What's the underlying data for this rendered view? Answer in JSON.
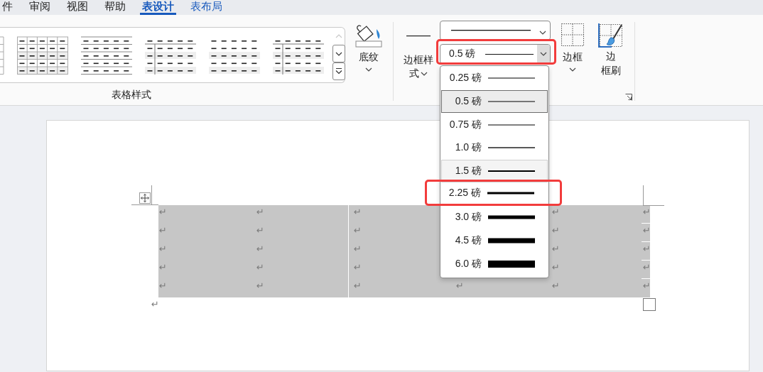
{
  "tabs": [
    {
      "label": "件",
      "selected": false,
      "kind": "normal"
    },
    {
      "label": "审阅",
      "selected": false,
      "kind": "normal"
    },
    {
      "label": "视图",
      "selected": false,
      "kind": "normal"
    },
    {
      "label": "帮助",
      "selected": false,
      "kind": "normal"
    },
    {
      "label": "表设计",
      "selected": true,
      "kind": "contextual"
    },
    {
      "label": "表布局",
      "selected": false,
      "kind": "contextual"
    }
  ],
  "table_styles": {
    "label": "表格样式",
    "scroll_up_disabled": true,
    "thumbnails": [
      {
        "kind": "partial"
      },
      {
        "kind": "grid"
      },
      {
        "kind": "lines"
      },
      {
        "kind": "header-column"
      },
      {
        "kind": "banded"
      },
      {
        "kind": "header-column"
      }
    ]
  },
  "shading": {
    "label": "底纹"
  },
  "border_styles": {
    "label_lines": [
      "边框样",
      "式"
    ]
  },
  "pen_weight": {
    "value": "0.5 磅",
    "expanded": true,
    "marked": true
  },
  "borders": {
    "label_lines": [
      "边框"
    ]
  },
  "border_painter": {
    "label_lines": [
      "边",
      "框刷"
    ]
  },
  "weight_options": [
    {
      "label": "0.25 磅",
      "selected": false,
      "hovered": false,
      "marked": false
    },
    {
      "label": "0.5 磅",
      "selected": true,
      "hovered": false,
      "marked": false
    },
    {
      "label": "0.75 磅",
      "selected": false,
      "hovered": false,
      "marked": false
    },
    {
      "label": "1.0 磅",
      "selected": false,
      "hovered": false,
      "marked": false
    },
    {
      "label": "1.5 磅",
      "selected": false,
      "hovered": true,
      "marked": false
    },
    {
      "label": "2.25 磅",
      "selected": false,
      "hovered": false,
      "marked": true
    },
    {
      "label": "3.0 磅",
      "selected": false,
      "hovered": false,
      "marked": false
    },
    {
      "label": "4.5 磅",
      "selected": false,
      "hovered": false,
      "marked": false
    },
    {
      "label": "6.0 磅",
      "selected": false,
      "hovered": false,
      "marked": false
    }
  ],
  "table": {
    "rows": [
      {
        "cells": [
          {
            "text": "↵"
          },
          {
            "text": "↵"
          },
          {
            "text": "↵"
          },
          {},
          {
            "text": "↵"
          }
        ],
        "end_mark": "↵"
      },
      {
        "cells": [
          {
            "text": "↵"
          },
          {
            "text": "↵"
          },
          {
            "text": "↵"
          },
          {},
          {
            "text": "↵"
          }
        ],
        "end_mark": "↵"
      },
      {
        "cells": [
          {
            "text": "↵"
          },
          {
            "text": "↵"
          },
          {
            "text": "↵"
          },
          {},
          {
            "text": "↵"
          }
        ],
        "end_mark": "↵"
      },
      {
        "cells": [
          {
            "text": "↵"
          },
          {
            "text": "↵"
          },
          {
            "text": "↵"
          },
          {},
          {
            "text": "↵"
          }
        ],
        "end_mark": "↵"
      },
      {
        "cells": [
          {
            "text": "↵"
          },
          {
            "text": "↵"
          },
          {
            "text": "↵"
          },
          {
            "text": "↵"
          },
          {
            "text": "↵"
          }
        ],
        "end_mark": "↵"
      }
    ]
  },
  "after_table_mark": "↵"
}
